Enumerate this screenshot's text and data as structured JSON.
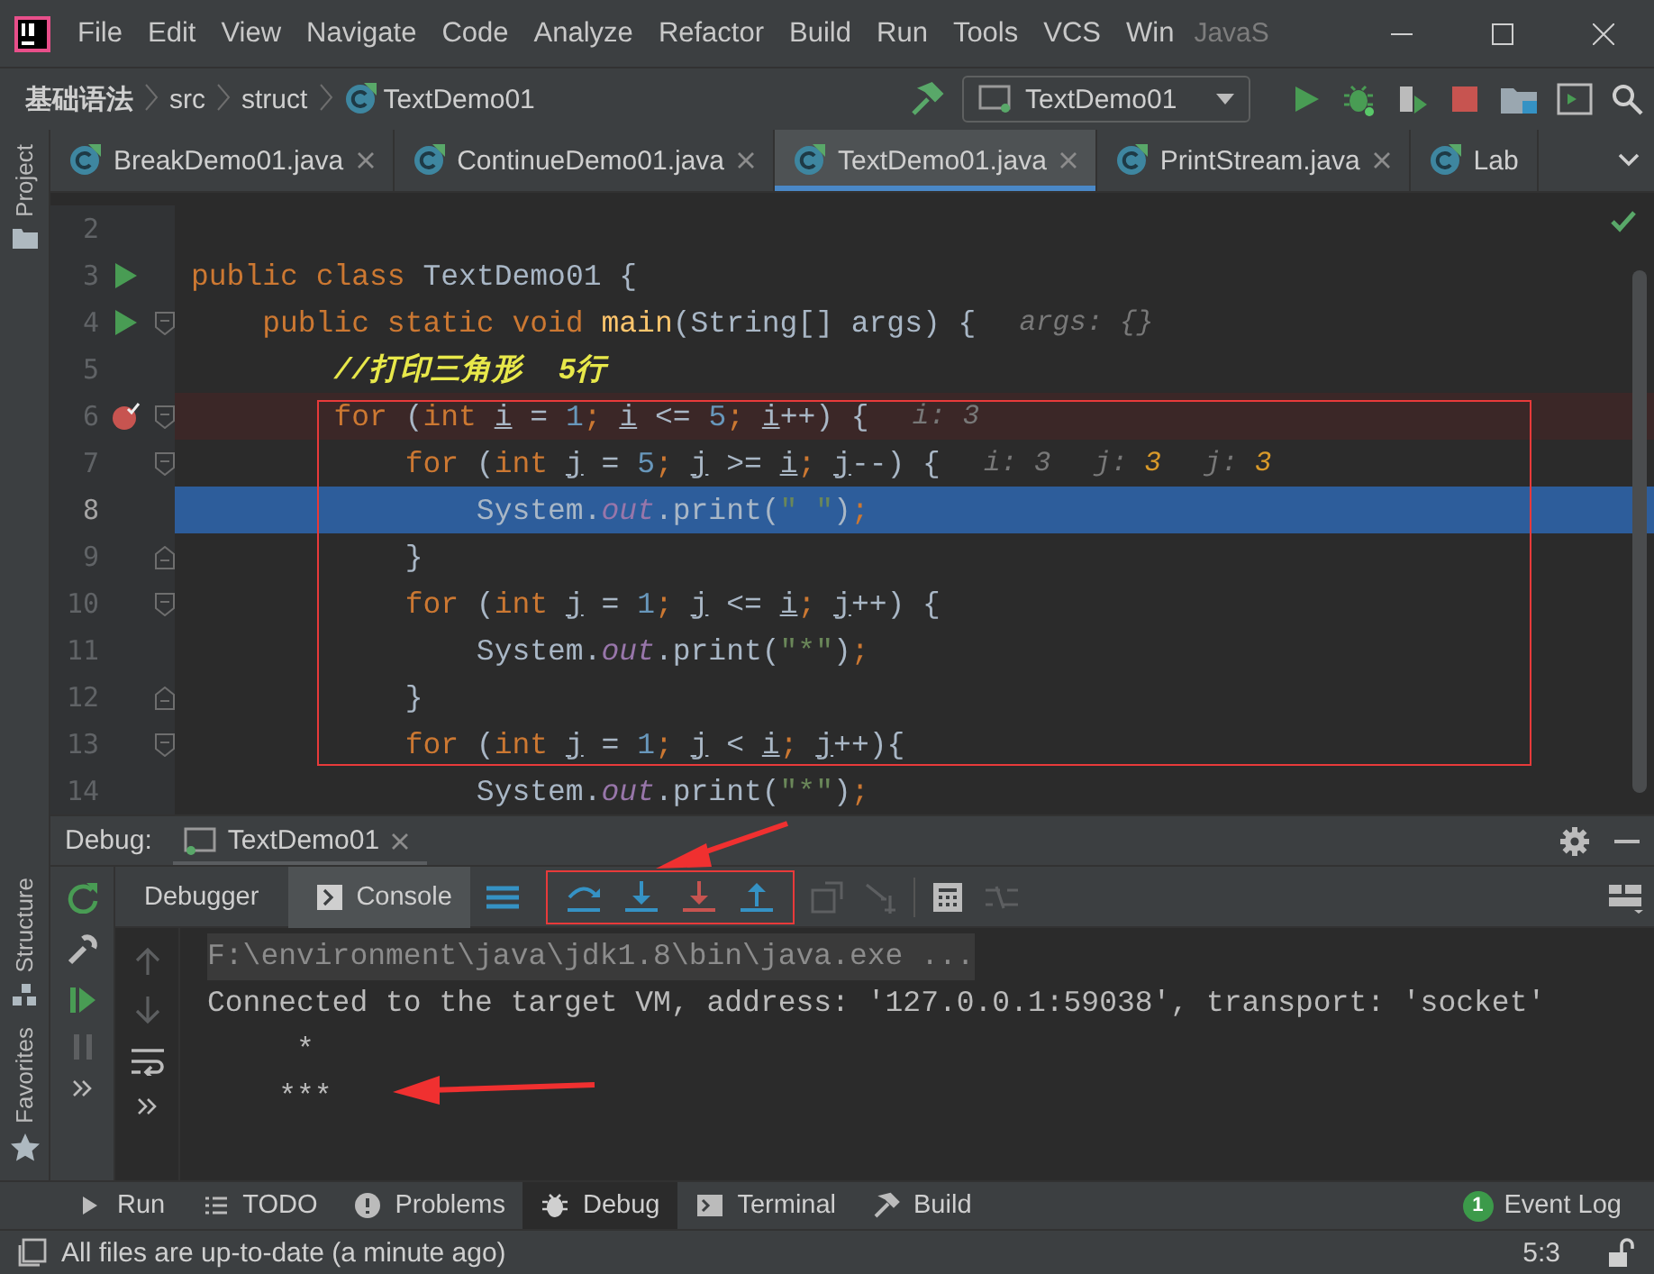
{
  "menu": [
    "File",
    "Edit",
    "View",
    "Navigate",
    "Code",
    "Analyze",
    "Refactor",
    "Build",
    "Run",
    "Tools",
    "VCS",
    "Win"
  ],
  "window_title": "JavaS",
  "breadcrumb": [
    "基础语法",
    "src",
    "struct",
    "TextDemo01"
  ],
  "run_config": "TextDemo01",
  "side_stripe": {
    "top": [
      "Project"
    ],
    "bottom": [
      "Structure",
      "Favorites"
    ]
  },
  "tabs": [
    {
      "label": "BreakDemo01.java",
      "selected": false,
      "closable": true
    },
    {
      "label": "ContinueDemo01.java",
      "selected": false,
      "closable": true
    },
    {
      "label": "TextDemo01.java",
      "selected": true,
      "closable": true
    },
    {
      "label": "PrintStream.java",
      "selected": false,
      "closable": true
    },
    {
      "label": "Lab",
      "selected": false,
      "closable": false
    }
  ],
  "lines": [
    {
      "number": "2",
      "current": false,
      "breakpoint": false,
      "run": false,
      "fold_start": false,
      "fold_end": false
    },
    {
      "number": "3",
      "current": false,
      "breakpoint": false,
      "run": true,
      "fold_start": false,
      "fold_end": false,
      "code": [
        {
          "text": "public ",
          "kind": "kw"
        },
        {
          "text": "class ",
          "kind": "kw"
        },
        {
          "text": "TextDemo01 {",
          "kind": "p"
        }
      ]
    },
    {
      "number": "4",
      "current": false,
      "breakpoint": false,
      "run": true,
      "fold_start": true,
      "fold_end": false,
      "code": [
        {
          "text": "    public static void ",
          "kind": "kw"
        },
        {
          "text": "main",
          "kind": "fn"
        },
        {
          "text": "(String[] args) {",
          "kind": "p"
        }
      ],
      "hints": [
        {
          "name": "args:",
          "value": "{}",
          "changed": false
        }
      ]
    },
    {
      "number": "5",
      "current": false,
      "breakpoint": false,
      "run": false,
      "fold_start": false,
      "fold_end": false,
      "code": [
        {
          "text": "        //打印三角形  5行",
          "kind": "comment"
        }
      ]
    },
    {
      "number": "6",
      "current": false,
      "breakpoint": true,
      "run": false,
      "fold_start": true,
      "fold_end": false,
      "code": [
        {
          "text": "        for",
          "kind": "kw"
        },
        {
          "text": " (",
          "kind": "p"
        },
        {
          "text": "int ",
          "kind": "kw"
        },
        {
          "text": "i",
          "kind": "var"
        },
        {
          "text": " = ",
          "kind": "p"
        },
        {
          "text": "1",
          "kind": "num"
        },
        {
          "text": "; ",
          "kind": "kw"
        },
        {
          "text": "i",
          "kind": "var"
        },
        {
          "text": " <= ",
          "kind": "p"
        },
        {
          "text": "5",
          "kind": "num"
        },
        {
          "text": "; ",
          "kind": "kw"
        },
        {
          "text": "i",
          "kind": "var"
        },
        {
          "text": "++) {",
          "kind": "p"
        }
      ],
      "hints": [
        {
          "name": "i:",
          "value": "3",
          "changed": false
        }
      ]
    },
    {
      "number": "7",
      "current": false,
      "breakpoint": false,
      "run": false,
      "fold_start": true,
      "fold_end": false,
      "code": [
        {
          "text": "            for",
          "kind": "kw"
        },
        {
          "text": " (",
          "kind": "p"
        },
        {
          "text": "int ",
          "kind": "kw"
        },
        {
          "text": "j",
          "kind": "var"
        },
        {
          "text": " = ",
          "kind": "p"
        },
        {
          "text": "5",
          "kind": "num"
        },
        {
          "text": "; ",
          "kind": "kw"
        },
        {
          "text": "j",
          "kind": "var"
        },
        {
          "text": " >= ",
          "kind": "p"
        },
        {
          "text": "i",
          "kind": "var"
        },
        {
          "text": "; ",
          "kind": "kw"
        },
        {
          "text": "j",
          "kind": "var"
        },
        {
          "text": "--) {",
          "kind": "p"
        }
      ],
      "hints": [
        {
          "name": "i:",
          "value": "3",
          "changed": false
        },
        {
          "name": "j:",
          "value": "3",
          "changed": true
        },
        {
          "name": "j:",
          "value": "3",
          "changed": true
        }
      ]
    },
    {
      "number": "8",
      "current": true,
      "breakpoint": false,
      "run": false,
      "fold_start": false,
      "fold_end": false,
      "code": [
        {
          "text": "                System.",
          "kind": "p"
        },
        {
          "text": "out",
          "kind": "field"
        },
        {
          "text": ".print(",
          "kind": "p"
        },
        {
          "text": "\" \"",
          "kind": "str"
        },
        {
          "text": ")",
          "kind": "p"
        },
        {
          "text": ";",
          "kind": "kw"
        }
      ]
    },
    {
      "number": "9",
      "current": false,
      "breakpoint": false,
      "run": false,
      "fold_start": false,
      "fold_end": true,
      "code": [
        {
          "text": "            }",
          "kind": "p"
        }
      ]
    },
    {
      "number": "10",
      "current": false,
      "breakpoint": false,
      "run": false,
      "fold_start": true,
      "fold_end": false,
      "code": [
        {
          "text": "            for",
          "kind": "kw"
        },
        {
          "text": " (",
          "kind": "p"
        },
        {
          "text": "int ",
          "kind": "kw"
        },
        {
          "text": "j",
          "kind": "var"
        },
        {
          "text": " = ",
          "kind": "p"
        },
        {
          "text": "1",
          "kind": "num"
        },
        {
          "text": "; ",
          "kind": "kw"
        },
        {
          "text": "j",
          "kind": "var"
        },
        {
          "text": " <= ",
          "kind": "p"
        },
        {
          "text": "i",
          "kind": "var"
        },
        {
          "text": "; ",
          "kind": "kw"
        },
        {
          "text": "j",
          "kind": "var"
        },
        {
          "text": "++) {",
          "kind": "p"
        }
      ]
    },
    {
      "number": "11",
      "current": false,
      "breakpoint": false,
      "run": false,
      "fold_start": false,
      "fold_end": false,
      "code": [
        {
          "text": "                System.",
          "kind": "p"
        },
        {
          "text": "out",
          "kind": "field"
        },
        {
          "text": ".print(",
          "kind": "p"
        },
        {
          "text": "\"*\"",
          "kind": "str"
        },
        {
          "text": ")",
          "kind": "p"
        },
        {
          "text": ";",
          "kind": "kw"
        }
      ]
    },
    {
      "number": "12",
      "current": false,
      "breakpoint": false,
      "run": false,
      "fold_start": false,
      "fold_end": true,
      "code": [
        {
          "text": "            }",
          "kind": "p"
        }
      ]
    },
    {
      "number": "13",
      "current": false,
      "breakpoint": false,
      "run": false,
      "fold_start": true,
      "fold_end": false,
      "code": [
        {
          "text": "            for",
          "kind": "kw"
        },
        {
          "text": " (",
          "kind": "p"
        },
        {
          "text": "int ",
          "kind": "kw"
        },
        {
          "text": "j",
          "kind": "var"
        },
        {
          "text": " = ",
          "kind": "p"
        },
        {
          "text": "1",
          "kind": "num"
        },
        {
          "text": "; ",
          "kind": "kw"
        },
        {
          "text": "j",
          "kind": "var"
        },
        {
          "text": " < ",
          "kind": "p"
        },
        {
          "text": "i",
          "kind": "var"
        },
        {
          "text": "; ",
          "kind": "kw"
        },
        {
          "text": "j",
          "kind": "var"
        },
        {
          "text": "++){",
          "kind": "p"
        }
      ]
    },
    {
      "number": "14",
      "current": false,
      "breakpoint": false,
      "run": false,
      "fold_start": false,
      "fold_end": false,
      "code": [
        {
          "text": "                System.",
          "kind": "p"
        },
        {
          "text": "out",
          "kind": "field"
        },
        {
          "text": ".print(",
          "kind": "p"
        },
        {
          "text": "\"*\"",
          "kind": "str"
        },
        {
          "text": ")",
          "kind": "p"
        },
        {
          "text": ";",
          "kind": "kw"
        }
      ]
    }
  ],
  "debug": {
    "label": "Debug:",
    "session": "TextDemo01",
    "tabs": [
      {
        "label": "Debugger",
        "selected": false
      },
      {
        "label": "Console",
        "selected": true
      }
    ]
  },
  "console": [
    {
      "text": "F:\\environment\\java\\jdk1.8\\bin\\java.exe ...",
      "kind": "folded"
    },
    {
      "text": "Connected to the target VM, address: '127.0.0.1:59038', transport: 'socket'",
      "kind": "plain"
    },
    {
      "text": "     *",
      "kind": "plain"
    },
    {
      "text": "    ***",
      "kind": "plain"
    }
  ],
  "tool_tabs": [
    {
      "label": "Run",
      "selected": false
    },
    {
      "label": "TODO",
      "selected": false
    },
    {
      "label": "Problems",
      "selected": false
    },
    {
      "label": "Debug",
      "selected": true
    },
    {
      "label": "Terminal",
      "selected": false
    },
    {
      "label": "Build",
      "selected": false
    }
  ],
  "event_log": {
    "label": "Event Log",
    "count": "1"
  },
  "status": {
    "message": "All files are up-to-date (a minute ago)",
    "position": "5:3"
  }
}
